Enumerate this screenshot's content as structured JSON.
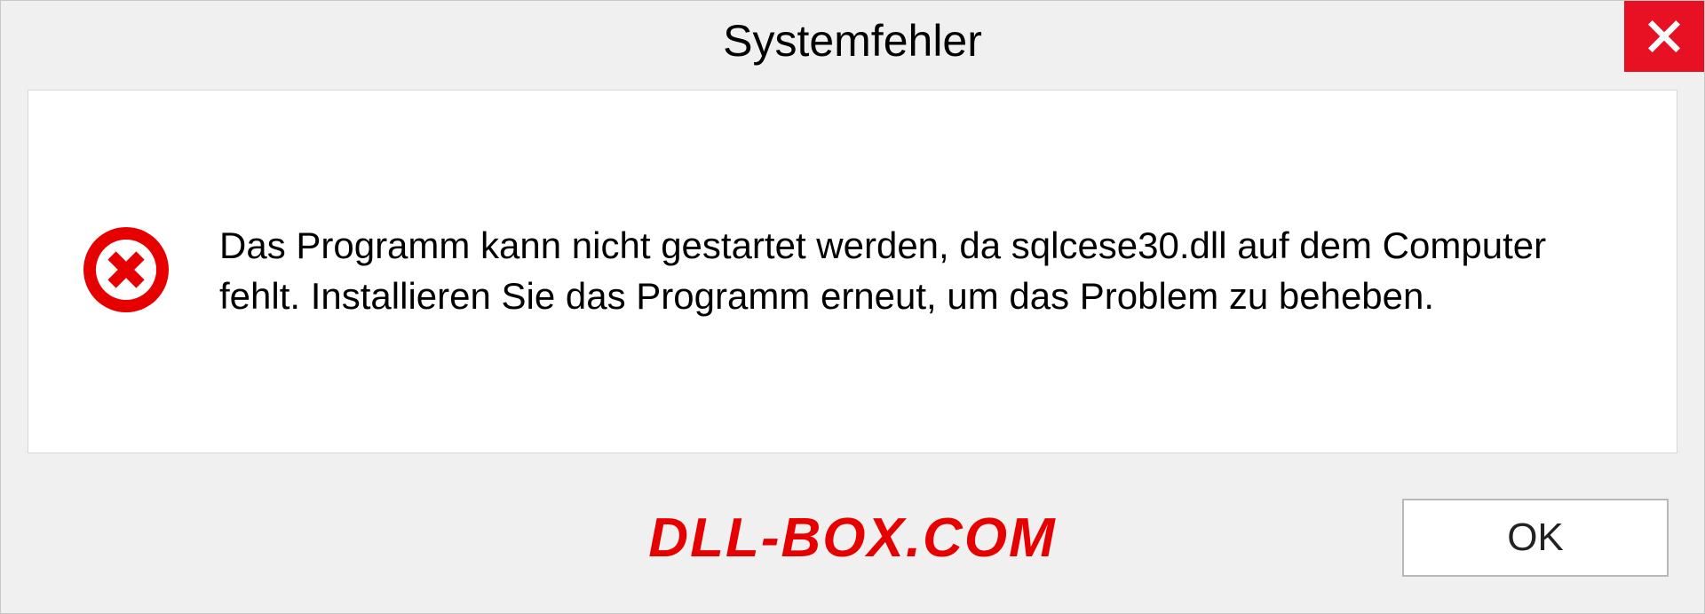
{
  "titlebar": {
    "title": "Systemfehler"
  },
  "message": {
    "text": "Das Programm kann nicht gestartet werden, da sqlcese30.dll auf dem Computer fehlt. Installieren Sie das Programm erneut, um das Problem zu beheben."
  },
  "footer": {
    "watermark": "DLL-BOX.COM",
    "ok_label": "OK"
  },
  "colors": {
    "close_bg": "#e81123",
    "error_icon": "#e60000",
    "watermark": "#e60000"
  }
}
